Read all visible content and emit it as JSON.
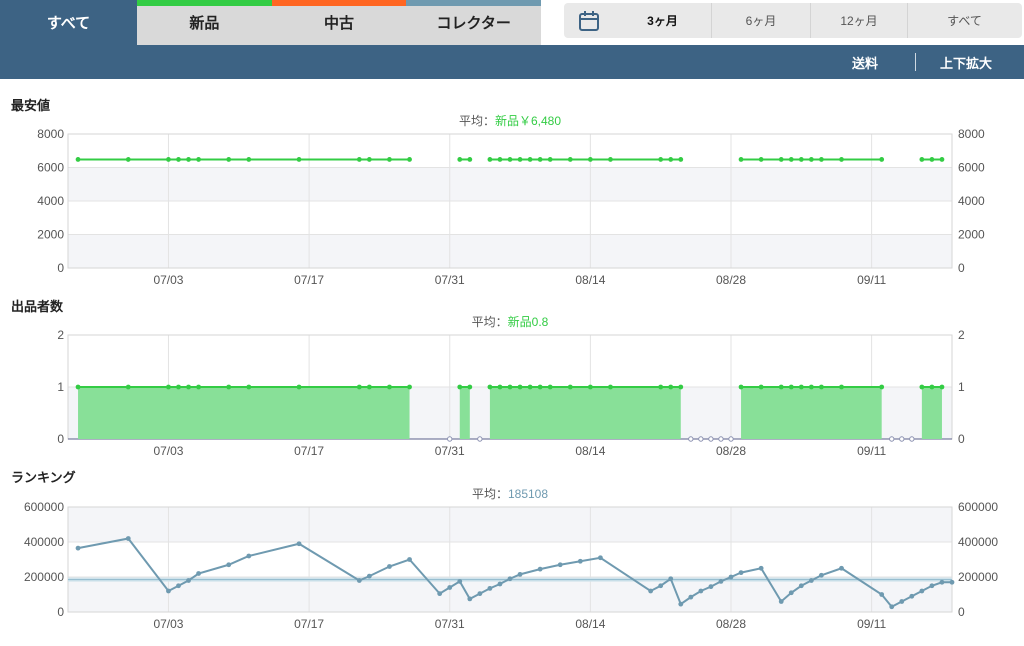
{
  "tabs": [
    {
      "label": "すべて",
      "stripe": null
    },
    {
      "label": "新品",
      "stripe": "#33cc44"
    },
    {
      "label": "中古",
      "stripe": "#ff6622"
    },
    {
      "label": "コレクター",
      "stripe": "#6f9ab0"
    }
  ],
  "range": {
    "options": [
      "3ヶ月",
      "6ヶ月",
      "12ヶ月",
      "すべて"
    ],
    "selected": 0
  },
  "toolbar": {
    "shipping": "送料",
    "expand": "上下拡大"
  },
  "colors": {
    "new": "#33cc44",
    "new_fill": "#88e098",
    "rank": "#6f9ab0",
    "header": "#3d6384"
  },
  "chart_data": [
    {
      "id": "price",
      "type": "line",
      "title": "最安値",
      "avg_prefix": "平均：",
      "avg_value": "新品￥6,480",
      "avg_color": "#33cc44",
      "ylim": [
        0,
        8000
      ],
      "yticks": [
        "0",
        "2000",
        "4000",
        "6000",
        "8000"
      ],
      "xlim": [
        "2024-06-23",
        "2024-09-19"
      ],
      "xticks": [
        "07/03",
        "07/17",
        "07/31",
        "08/14",
        "08/28",
        "09/11"
      ],
      "tick_dates": [
        "2024-07-03",
        "2024-07-17",
        "2024-07-31",
        "2024-08-14",
        "2024-08-28",
        "2024-09-11"
      ],
      "series": [
        {
          "color": "#33cc44",
          "segments": [
            [
              [
                "2024-06-24",
                6480
              ],
              [
                "2024-06-29",
                6480
              ],
              [
                "2024-07-03",
                6480
              ],
              [
                "2024-07-04",
                6480
              ],
              [
                "2024-07-05",
                6480
              ],
              [
                "2024-07-06",
                6480
              ],
              [
                "2024-07-09",
                6480
              ],
              [
                "2024-07-11",
                6480
              ],
              [
                "2024-07-16",
                6480
              ],
              [
                "2024-07-22",
                6480
              ],
              [
                "2024-07-23",
                6480
              ],
              [
                "2024-07-25",
                6480
              ],
              [
                "2024-07-27",
                6480
              ]
            ],
            [
              [
                "2024-08-01",
                6480
              ],
              [
                "2024-08-02",
                6480
              ]
            ],
            [
              [
                "2024-08-04",
                6480
              ],
              [
                "2024-08-05",
                6480
              ],
              [
                "2024-08-06",
                6480
              ],
              [
                "2024-08-07",
                6480
              ],
              [
                "2024-08-08",
                6480
              ],
              [
                "2024-08-09",
                6480
              ],
              [
                "2024-08-10",
                6480
              ],
              [
                "2024-08-12",
                6480
              ],
              [
                "2024-08-14",
                6480
              ],
              [
                "2024-08-16",
                6480
              ],
              [
                "2024-08-21",
                6480
              ],
              [
                "2024-08-22",
                6480
              ],
              [
                "2024-08-23",
                6480
              ]
            ],
            [
              [
                "2024-08-29",
                6480
              ],
              [
                "2024-08-31",
                6480
              ],
              [
                "2024-09-02",
                6480
              ],
              [
                "2024-09-03",
                6480
              ],
              [
                "2024-09-04",
                6480
              ],
              [
                "2024-09-05",
                6480
              ],
              [
                "2024-09-06",
                6480
              ],
              [
                "2024-09-08",
                6480
              ],
              [
                "2024-09-12",
                6480
              ]
            ],
            [
              [
                "2024-09-16",
                6480
              ],
              [
                "2024-09-17",
                6480
              ],
              [
                "2024-09-18",
                6480
              ]
            ]
          ]
        }
      ]
    },
    {
      "id": "sellers",
      "type": "area",
      "title": "出品者数",
      "avg_prefix": "平均：",
      "avg_value": "新品0.8",
      "avg_color": "#33cc44",
      "ylim": [
        0,
        2
      ],
      "yticks": [
        "0",
        "1",
        "2"
      ],
      "xlim": [
        "2024-06-23",
        "2024-09-19"
      ],
      "xticks": [
        "07/03",
        "07/17",
        "07/31",
        "08/14",
        "08/28",
        "09/11"
      ],
      "tick_dates": [
        "2024-07-03",
        "2024-07-17",
        "2024-07-31",
        "2024-08-14",
        "2024-08-28",
        "2024-09-11"
      ],
      "series": [
        {
          "color": "#33cc44",
          "segments": [
            [
              [
                "2024-06-24",
                1
              ],
              [
                "2024-06-29",
                1
              ],
              [
                "2024-07-03",
                1
              ],
              [
                "2024-07-04",
                1
              ],
              [
                "2024-07-05",
                1
              ],
              [
                "2024-07-06",
                1
              ],
              [
                "2024-07-09",
                1
              ],
              [
                "2024-07-11",
                1
              ],
              [
                "2024-07-16",
                1
              ],
              [
                "2024-07-22",
                1
              ],
              [
                "2024-07-23",
                1
              ],
              [
                "2024-07-25",
                1
              ],
              [
                "2024-07-27",
                1
              ]
            ],
            [
              [
                "2024-08-01",
                1
              ],
              [
                "2024-08-02",
                1
              ]
            ],
            [
              [
                "2024-08-04",
                1
              ],
              [
                "2024-08-05",
                1
              ],
              [
                "2024-08-06",
                1
              ],
              [
                "2024-08-07",
                1
              ],
              [
                "2024-08-08",
                1
              ],
              [
                "2024-08-09",
                1
              ],
              [
                "2024-08-10",
                1
              ],
              [
                "2024-08-12",
                1
              ],
              [
                "2024-08-14",
                1
              ],
              [
                "2024-08-16",
                1
              ],
              [
                "2024-08-21",
                1
              ],
              [
                "2024-08-22",
                1
              ],
              [
                "2024-08-23",
                1
              ]
            ],
            [
              [
                "2024-08-29",
                1
              ],
              [
                "2024-08-31",
                1
              ],
              [
                "2024-09-02",
                1
              ],
              [
                "2024-09-03",
                1
              ],
              [
                "2024-09-04",
                1
              ],
              [
                "2024-09-05",
                1
              ],
              [
                "2024-09-06",
                1
              ],
              [
                "2024-09-08",
                1
              ],
              [
                "2024-09-12",
                1
              ]
            ],
            [
              [
                "2024-09-16",
                1
              ],
              [
                "2024-09-17",
                1
              ],
              [
                "2024-09-18",
                1
              ]
            ]
          ]
        }
      ],
      "zero_points": [
        "2024-07-31",
        "2024-08-03",
        "2024-08-24",
        "2024-08-25",
        "2024-08-26",
        "2024-08-27",
        "2024-08-28",
        "2024-09-13",
        "2024-09-14",
        "2024-09-15"
      ]
    },
    {
      "id": "ranking",
      "type": "line",
      "title": "ランキング",
      "avg_prefix": "平均：",
      "avg_value": "185108",
      "avg_color": "#6f9ab0",
      "average_line": 185108,
      "ylim": [
        0,
        600000
      ],
      "yticks": [
        "0",
        "200000",
        "400000",
        "600000"
      ],
      "xlim": [
        "2024-06-23",
        "2024-09-19"
      ],
      "xticks": [
        "07/03",
        "07/17",
        "07/31",
        "08/14",
        "08/28",
        "09/11"
      ],
      "tick_dates": [
        "2024-07-03",
        "2024-07-17",
        "2024-07-31",
        "2024-08-14",
        "2024-08-28",
        "2024-09-11"
      ],
      "series": [
        {
          "color": "#6f9ab0",
          "segments": [
            [
              [
                "2024-06-24",
                365000
              ],
              [
                "2024-06-29",
                420000
              ],
              [
                "2024-07-03",
                120000
              ],
              [
                "2024-07-04",
                150000
              ],
              [
                "2024-07-05",
                180000
              ],
              [
                "2024-07-06",
                220000
              ],
              [
                "2024-07-09",
                270000
              ],
              [
                "2024-07-11",
                320000
              ],
              [
                "2024-07-16",
                390000
              ],
              [
                "2024-07-22",
                180000
              ],
              [
                "2024-07-23",
                205000
              ],
              [
                "2024-07-25",
                260000
              ],
              [
                "2024-07-27",
                300000
              ],
              [
                "2024-07-30",
                105000
              ],
              [
                "2024-07-31",
                140000
              ],
              [
                "2024-08-01",
                175000
              ],
              [
                "2024-08-02",
                75000
              ],
              [
                "2024-08-03",
                105000
              ],
              [
                "2024-08-04",
                135000
              ],
              [
                "2024-08-05",
                160000
              ],
              [
                "2024-08-06",
                190000
              ],
              [
                "2024-08-07",
                215000
              ],
              [
                "2024-08-09",
                245000
              ],
              [
                "2024-08-11",
                270000
              ],
              [
                "2024-08-13",
                290000
              ],
              [
                "2024-08-15",
                310000
              ],
              [
                "2024-08-20",
                120000
              ],
              [
                "2024-08-21",
                150000
              ],
              [
                "2024-08-22",
                190000
              ],
              [
                "2024-08-23",
                45000
              ],
              [
                "2024-08-24",
                85000
              ],
              [
                "2024-08-25",
                120000
              ],
              [
                "2024-08-26",
                145000
              ],
              [
                "2024-08-27",
                175000
              ],
              [
                "2024-08-28",
                200000
              ],
              [
                "2024-08-29",
                225000
              ],
              [
                "2024-08-31",
                250000
              ],
              [
                "2024-09-02",
                60000
              ],
              [
                "2024-09-03",
                110000
              ],
              [
                "2024-09-04",
                150000
              ],
              [
                "2024-09-05",
                180000
              ],
              [
                "2024-09-06",
                210000
              ],
              [
                "2024-09-08",
                250000
              ],
              [
                "2024-09-12",
                100000
              ],
              [
                "2024-09-13",
                30000
              ],
              [
                "2024-09-14",
                60000
              ],
              [
                "2024-09-15",
                90000
              ],
              [
                "2024-09-16",
                120000
              ],
              [
                "2024-09-17",
                150000
              ],
              [
                "2024-09-18",
                170000
              ],
              [
                "2024-09-19",
                170000
              ]
            ]
          ]
        }
      ]
    }
  ]
}
